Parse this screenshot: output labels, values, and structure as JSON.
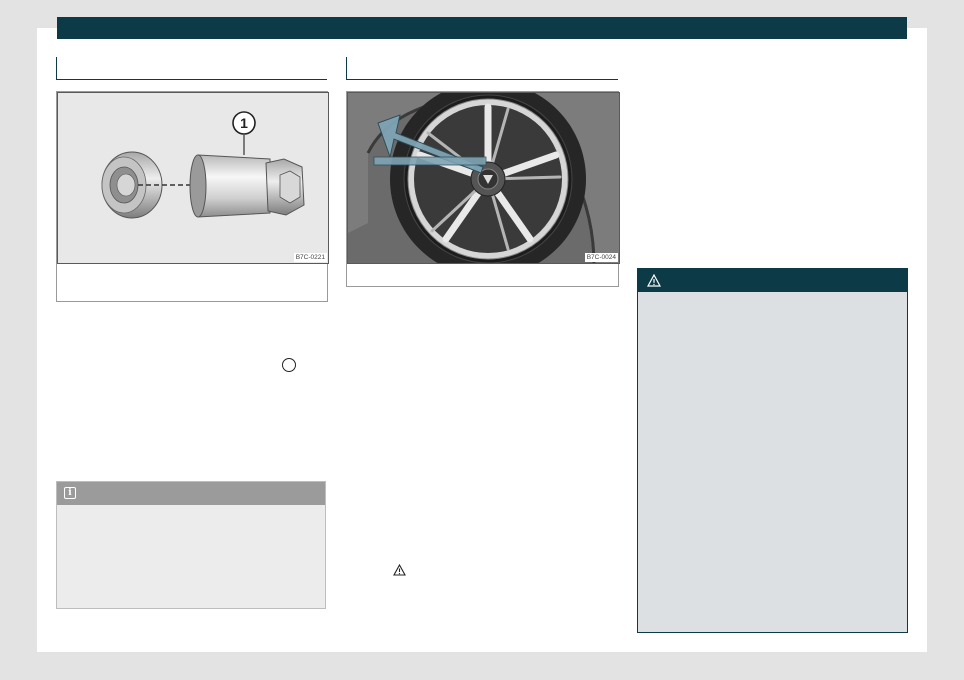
{
  "figures": [
    {
      "code": "B7C-0221",
      "callout": "1"
    },
    {
      "code": "B7C-0024"
    }
  ],
  "icons": {
    "note": "info-icon",
    "warning": "warning-triangle-icon"
  },
  "colors": {
    "brand": "#0c3a47",
    "note_header": "#9b9b9b",
    "note_body": "#ececec",
    "warning_body": "#dde0e3"
  }
}
